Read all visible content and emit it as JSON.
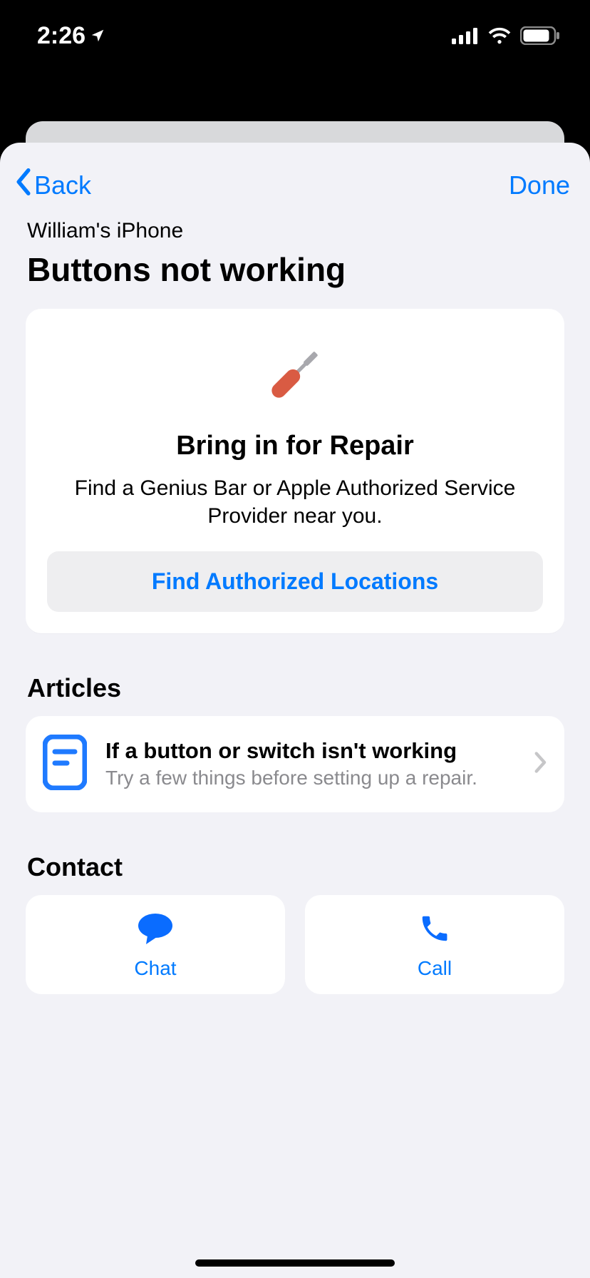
{
  "statusbar": {
    "time": "2:26"
  },
  "nav": {
    "back": "Back",
    "done": "Done"
  },
  "header": {
    "device": "William's iPhone",
    "title": "Buttons not working"
  },
  "repair": {
    "title": "Bring in for Repair",
    "body": "Find a Genius Bar or Apple Authorized Service Provider near you.",
    "cta": "Find Authorized Locations"
  },
  "sections": {
    "articles": "Articles",
    "contact": "Contact"
  },
  "article": {
    "title": "If a button or switch isn't working",
    "subtitle": "Try a few things before setting up a repair."
  },
  "contact": {
    "chat": "Chat",
    "call": "Call"
  }
}
